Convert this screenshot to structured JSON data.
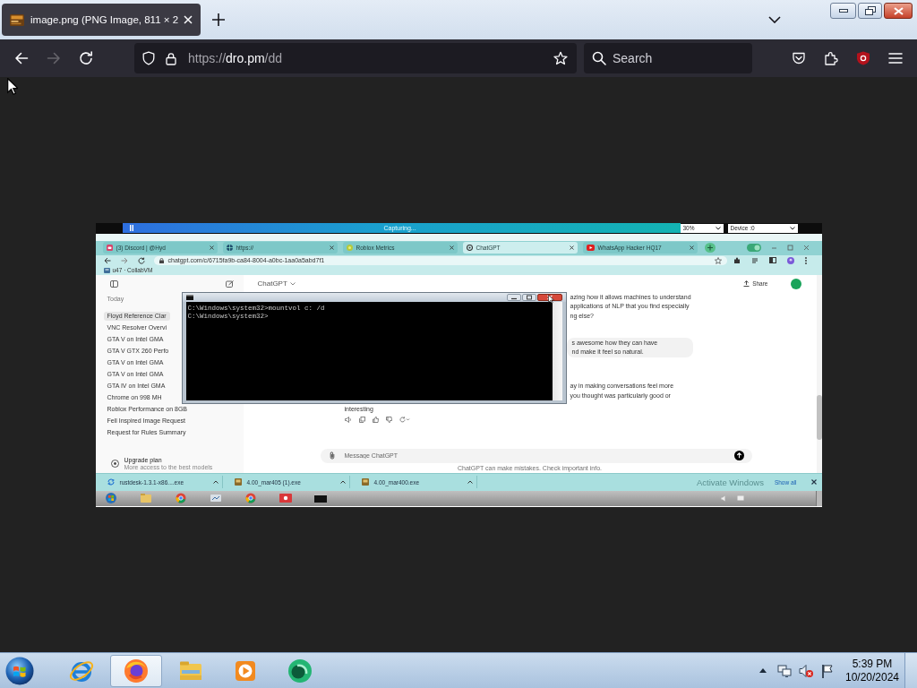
{
  "browser": {
    "tabs": [
      {
        "title": "image.png (PNG Image, 811 × 2",
        "selected": true
      }
    ],
    "nav_buttons": [
      {
        "kind": "back",
        "disabled": false
      },
      {
        "kind": "forward",
        "disabled": true
      },
      {
        "kind": "reload",
        "disabled": false
      }
    ],
    "url": {
      "prefix": "https://",
      "host": "dro.pm",
      "path": "/dd"
    },
    "search": {
      "placeholder": "Search"
    }
  },
  "screenshot": {
    "capture_bar": {
      "status": "Capturing...",
      "quality": "30%",
      "device": "Device :0"
    },
    "chrome": {
      "tabs": [
        {
          "kind": "discord",
          "title": "(3) Discord | @Hyd",
          "selected": false
        },
        {
          "kind": "web",
          "title": "https://",
          "selected": false
        },
        {
          "kind": "web2",
          "title": "Roblox Metrics",
          "selected": false
        },
        {
          "kind": "chatgpt",
          "title": "ChatGPT",
          "selected": true
        },
        {
          "kind": "youtube",
          "title": "WhatsApp Hacker HQ17",
          "selected": false
        }
      ],
      "address": "chatgpt.com/c/6715fa9b-ca84-8004-a0bc-1aa0a5abd7f1",
      "bookmarks": [
        "u47 · CollabVM"
      ]
    },
    "chatgpt": {
      "sidebar": {
        "section": "Today",
        "items": [
          {
            "title": "Floyd Reference Clar",
            "selected": true
          },
          {
            "title": "VNC Resolver Overvi",
            "selected": false
          },
          {
            "title": "GTA V on Intel GMA",
            "selected": false
          },
          {
            "title": "GTA V GTX 260 Perfo",
            "selected": false
          },
          {
            "title": "GTA V on Intel GMA",
            "selected": false
          },
          {
            "title": "GTA V on Intel GMA",
            "selected": false
          },
          {
            "title": "GTA IV on Intel GMA",
            "selected": false
          },
          {
            "title": "Chrome on 998 MH",
            "selected": false
          },
          {
            "title": "Roblox Performance on 8GB",
            "selected": false
          },
          {
            "title": "Fell Inspired Image Request",
            "selected": false
          },
          {
            "title": "Request for Rules Summary",
            "selected": false
          }
        ],
        "upgrade": {
          "title": "Upgrade plan",
          "subtitle": "More access to the best models"
        }
      },
      "header": {
        "title": "ChatGPT",
        "share": "Share"
      },
      "messages": [
        {
          "kind": "assistant",
          "lines": [
            "azing how it allows machines to understand",
            "applications of NLP that you find especially",
            "ng else?"
          ]
        },
        {
          "kind": "user",
          "lines": [
            "s awesome how they can have",
            "nd make it feel so natural."
          ]
        },
        {
          "kind": "assistant",
          "lines": [
            "ay in making conversations feel more",
            "you thought was particularly good or"
          ]
        }
      ],
      "trailing": "interesting",
      "composer": {
        "placeholder": "Message ChatGPT"
      },
      "disclaimer": "ChatGPT can make mistakes. Check important info."
    },
    "cmd": {
      "lines": [
        "C:\\Windows\\system32>mountvol c: /d",
        "C:\\Windows\\system32>"
      ]
    },
    "downloads": {
      "items": [
        {
          "kind": "rustdesk",
          "name": "rustdesk-1.3.1-x86....exe"
        },
        {
          "kind": "setup",
          "name": "4.00_mar405 (1).exe"
        },
        {
          "kind": "setup",
          "name": "4.00_mar400.exe"
        }
      ],
      "activation_notice": "Activate Windows",
      "show_all": "Show all"
    },
    "taskbar": {
      "apps": [
        {
          "kind": "start"
        },
        {
          "kind": "folder"
        },
        {
          "kind": "chrome"
        },
        {
          "kind": "network"
        },
        {
          "kind": "chrome"
        },
        {
          "kind": "recorder"
        },
        {
          "kind": "cmd"
        }
      ]
    }
  },
  "taskbar": {
    "apps": [
      {
        "kind": "internet-explorer",
        "selected": false
      },
      {
        "kind": "firefox",
        "selected": true
      },
      {
        "kind": "file-explorer",
        "selected": false
      },
      {
        "kind": "media-player",
        "selected": false
      },
      {
        "kind": "green-app",
        "selected": false
      }
    ],
    "clock": {
      "time": "5:39 PM",
      "date": "10/20/2024"
    }
  }
}
